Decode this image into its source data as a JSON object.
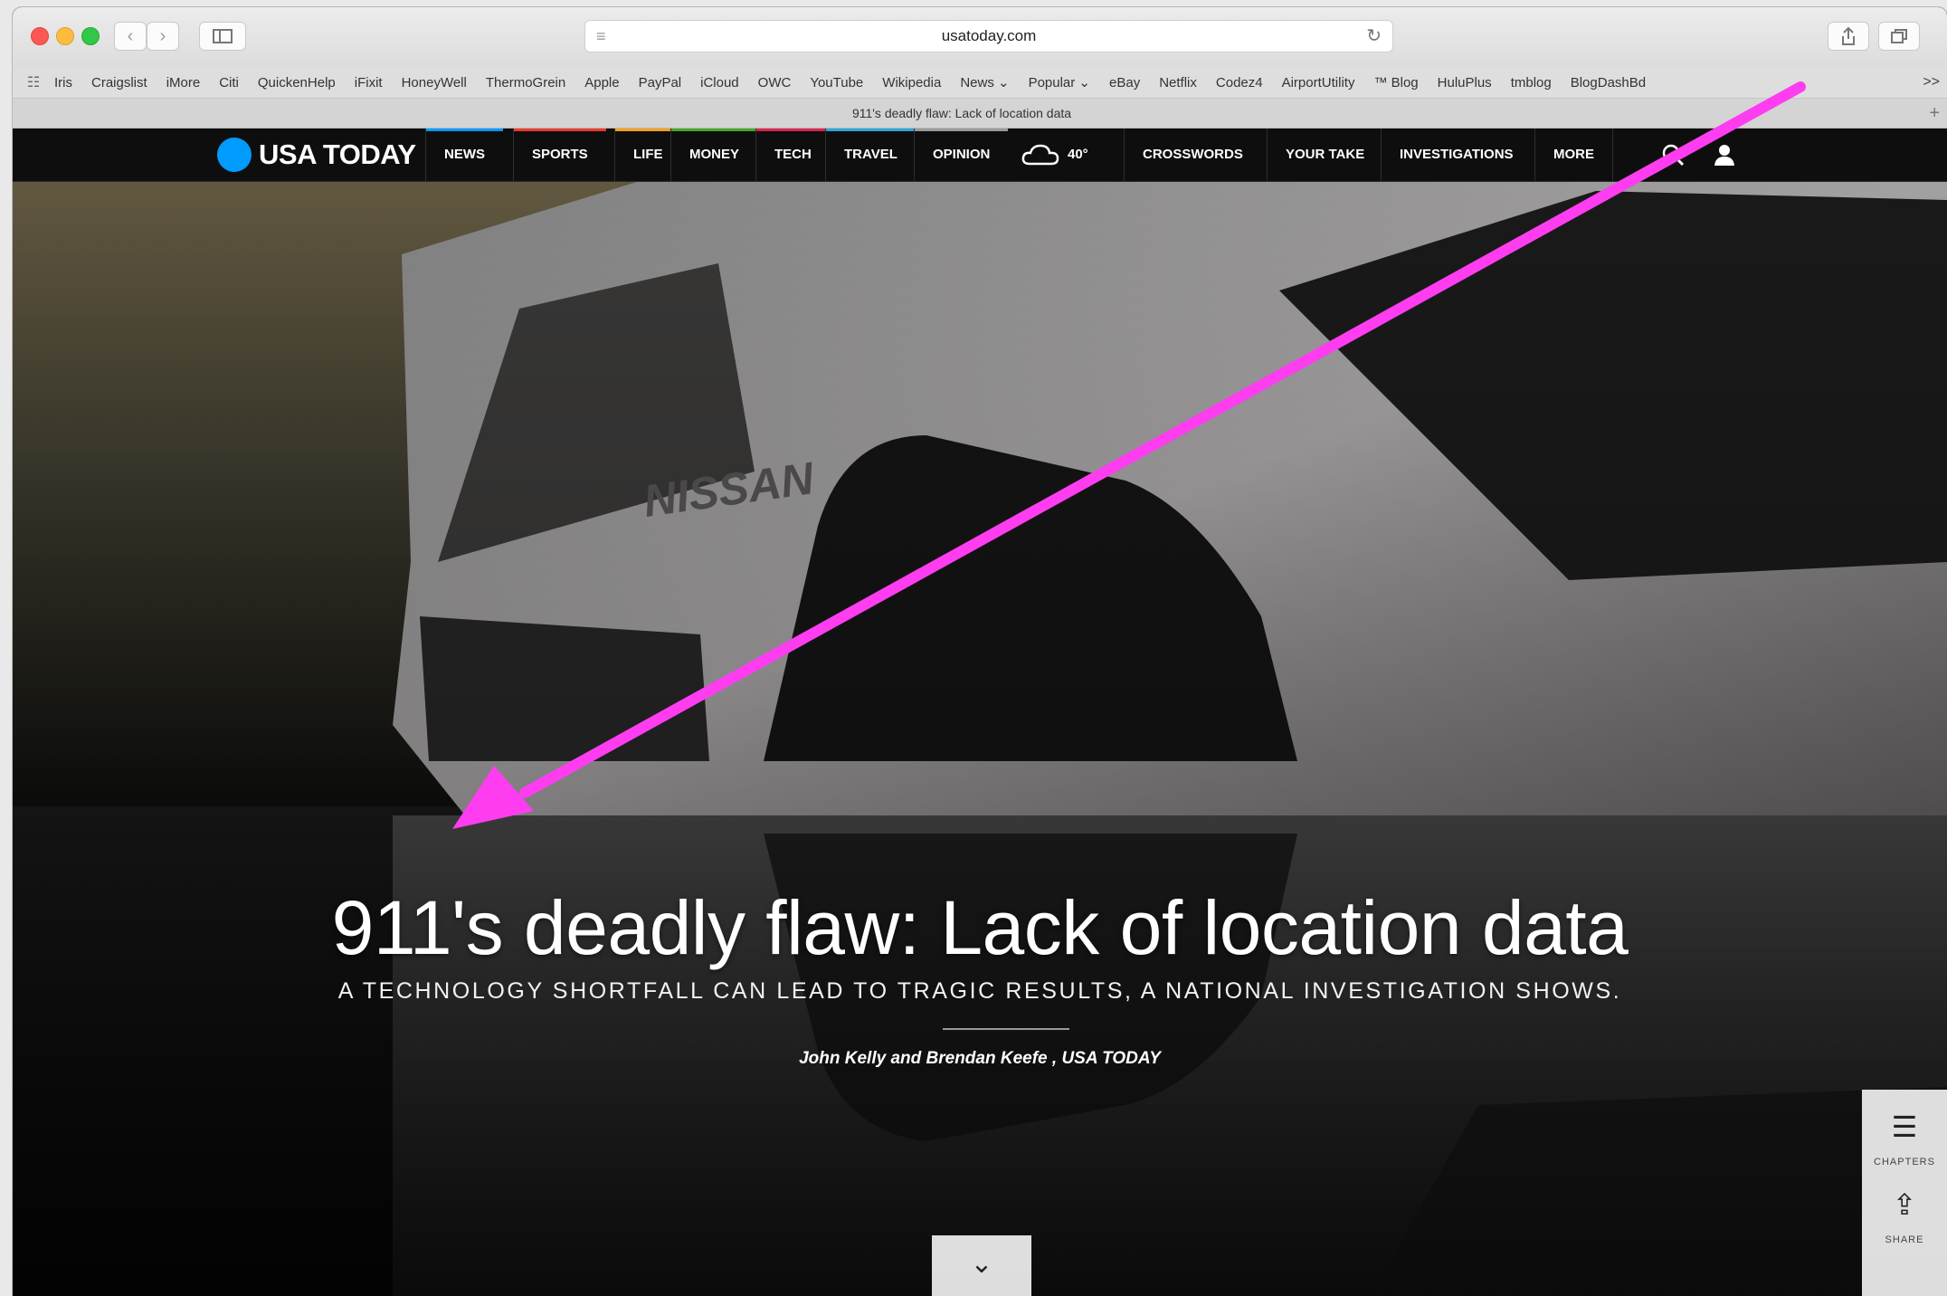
{
  "browser": {
    "url": "usatoday.com",
    "tab_title": "911's deadly flaw: Lack of location data",
    "bookmarks": [
      "Iris",
      "Craigslist",
      "iMore",
      "Citi",
      "QuickenHelp",
      "iFixit",
      "HoneyWell",
      "ThermoGrein",
      "Apple",
      "PayPal",
      "iCloud",
      "OWC",
      "YouTube",
      "Wikipedia",
      "News ⌄",
      "Popular ⌄",
      "eBay",
      "Netflix",
      "Codez4",
      "AirportUtility",
      "™ Blog",
      "HuluPlus",
      "tmblog",
      "BlogDashBd"
    ],
    "bookmarks_overflow": ">>"
  },
  "site": {
    "logo": "USA TODAY",
    "nav": [
      "NEWS",
      "SPORTS",
      "LIFE",
      "MONEY",
      "TECH",
      "TRAVEL",
      "OPINION"
    ],
    "weather_temp": "40°",
    "nav_right": [
      "CROSSWORDS",
      "YOUR TAKE",
      "INVESTIGATIONS",
      "MORE"
    ]
  },
  "article": {
    "headline": "911's deadly flaw: Lack of location data",
    "subhead": "A TECHNOLOGY SHORTFALL CAN LEAD TO TRAGIC RESULTS, A NATIONAL INVESTIGATION SHOWS.",
    "byline": "John Kelly and Brendan Keefe , USA TODAY",
    "vehicle_badge": "NISSAN"
  },
  "side_panel": {
    "chapters_label": "CHAPTERS",
    "share_label": "SHARE"
  },
  "colors": {
    "annotation_arrow": "#ff3df0",
    "logo_blue": "#009bff",
    "nav_bg": "#0e0e0e",
    "nav_accents": [
      "#009bff",
      "#e93a2f",
      "#f3a01d",
      "#46a72c",
      "#d9254f",
      "#2aa7d6",
      "#9a9a9a"
    ]
  },
  "icons": [
    "reader-icon",
    "reload-icon",
    "share-icon",
    "tabs-icon",
    "sidebar-icon",
    "search-icon",
    "user-icon",
    "cloud-icon",
    "chapters-icon",
    "chevron-down-icon"
  ]
}
